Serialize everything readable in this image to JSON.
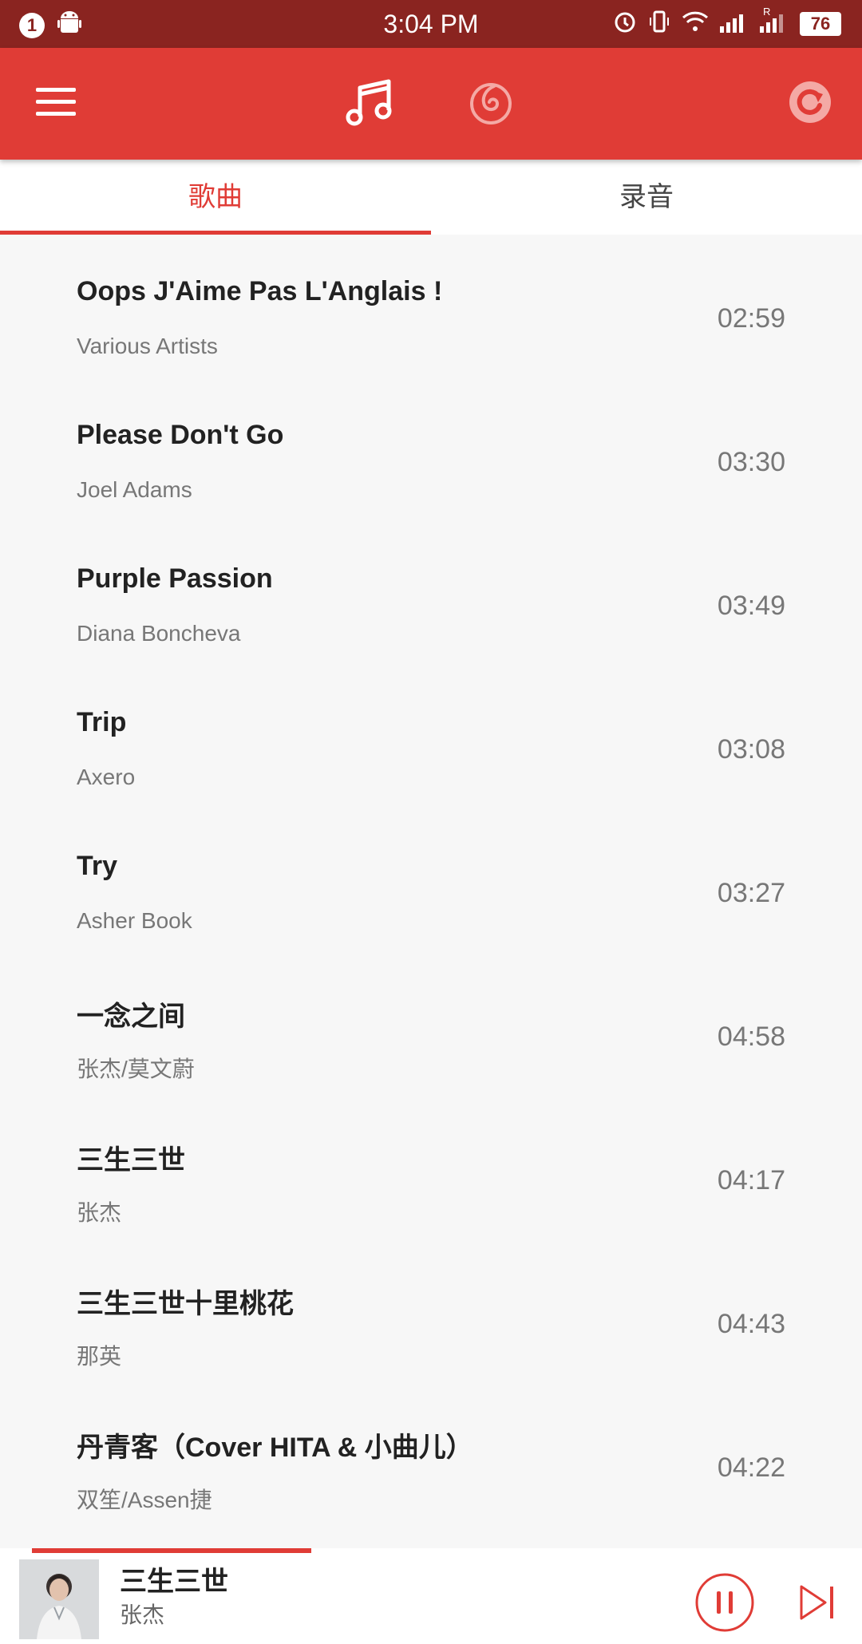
{
  "status_bar": {
    "notification_count": "1",
    "time": "3:04 PM",
    "battery": "76",
    "roaming_label": "R"
  },
  "toolbar": {
    "icons": [
      "menu-icon",
      "music-note-icon",
      "netease-cloud-icon",
      "refresh-icon"
    ]
  },
  "tabs": [
    {
      "label": "歌曲",
      "active": true
    },
    {
      "label": "录音",
      "active": false
    }
  ],
  "songs": [
    {
      "title": "Oops J'Aime Pas L'Anglais !",
      "artist": "Various Artists",
      "duration": "02:59"
    },
    {
      "title": "Please Don't Go",
      "artist": "Joel Adams",
      "duration": "03:30"
    },
    {
      "title": "Purple Passion",
      "artist": "Diana Boncheva",
      "duration": "03:49"
    },
    {
      "title": "Trip",
      "artist": "Axero",
      "duration": "03:08"
    },
    {
      "title": "Try",
      "artist": "Asher Book",
      "duration": "03:27"
    },
    {
      "title": "一念之间",
      "artist": "张杰/莫文蔚",
      "duration": "04:58"
    },
    {
      "title": "三生三世",
      "artist": "张杰",
      "duration": "04:17"
    },
    {
      "title": "三生三世十里桃花",
      "artist": "那英",
      "duration": "04:43"
    },
    {
      "title": "丹青客（Cover HITA & 小曲儿）",
      "artist": "双笙/Assen捷",
      "duration": "04:22"
    }
  ],
  "player": {
    "title": "三生三世",
    "artist": "张杰",
    "progress": 0.35,
    "state": "playing"
  },
  "colors": {
    "accent": "#e03c36",
    "status_bar": "#8a2420"
  }
}
